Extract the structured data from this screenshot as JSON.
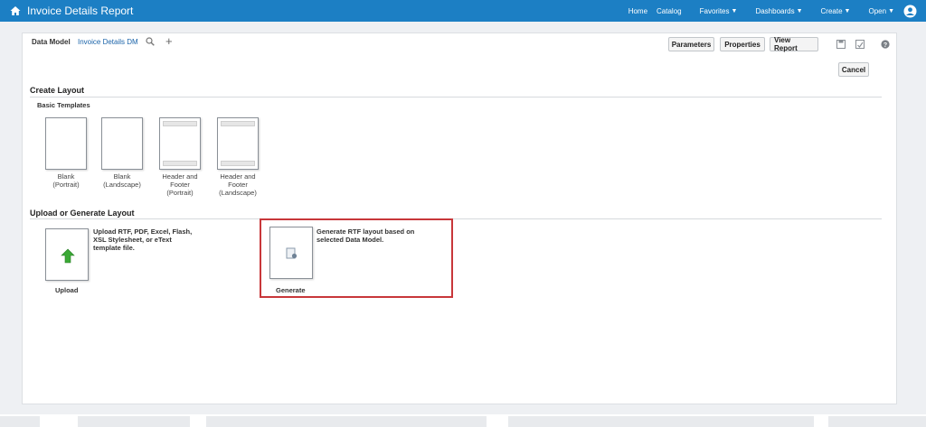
{
  "header": {
    "title": "Invoice Details Report",
    "nav": {
      "home": "Home",
      "catalog": "Catalog",
      "favorites": "Favorites",
      "dashboards": "Dashboards",
      "create": "Create",
      "open": "Open"
    }
  },
  "toolbar": {
    "data_model_label": "Data Model",
    "data_model_name": "Invoice Details DM",
    "parameters": "Parameters",
    "properties": "Properties",
    "view_report": "View Report",
    "cancel": "Cancel"
  },
  "create_layout": {
    "title": "Create Layout",
    "subhead": "Basic Templates",
    "templates": [
      {
        "line1": "Blank",
        "line2": "(Portrait)"
      },
      {
        "line1": "Blank",
        "line2": "(Landscape)"
      },
      {
        "line1": "Header and",
        "line2": "Footer",
        "line3": "(Portrait)"
      },
      {
        "line1": "Header and",
        "line2": "Footer",
        "line3": "(Landscape)"
      }
    ]
  },
  "upload_generate": {
    "title": "Upload or Generate Layout",
    "upload": {
      "label": "Upload",
      "desc1": "Upload RTF, PDF, Excel, Flash,",
      "desc2": "XSL Stylesheet, or eText",
      "desc3": "template file."
    },
    "generate": {
      "label": "Generate",
      "desc1": "Generate RTF layout based on",
      "desc2": "selected Data Model."
    }
  },
  "colors": {
    "header_bg": "#1c7fc4",
    "highlight": "#c8373a",
    "upload_arrow": "#3aa935"
  }
}
